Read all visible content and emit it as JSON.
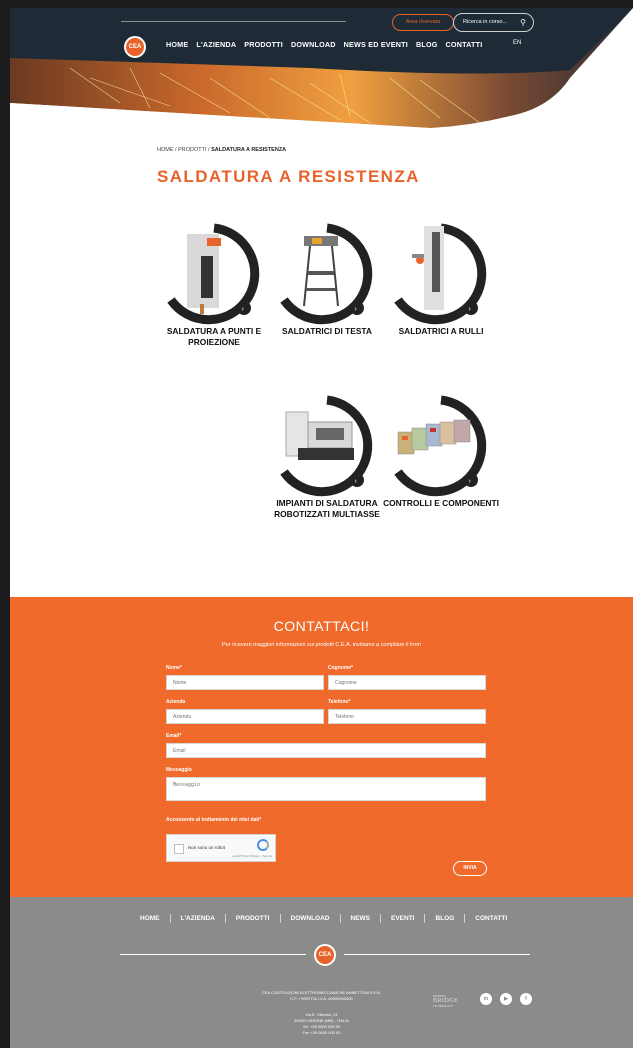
{
  "header": {
    "area_button": "Area riservata",
    "search_placeholder": "Ricerca in corso...",
    "logo": "CEA",
    "nav": [
      "HOME",
      "L'AZIENDA",
      "PRODOTTI",
      "DOWNLOAD",
      "NEWS ED EVENTI",
      "BLOG",
      "CONTATTI"
    ],
    "lang": "EN"
  },
  "breadcrumb": {
    "path": "HOME / PRODOTTI / ",
    "current": "SALDATURA A RESISTENZA"
  },
  "page_title": "SALDATURA A RESISTENZA",
  "products": [
    {
      "label": "SALDATURA A PUNTI E PROIEZIONE"
    },
    {
      "label": "SALDATRICI DI TESTA"
    },
    {
      "label": "SALDATRICI A RULLI"
    },
    {
      "label": "IMPIANTI DI SALDATURA ROBOTIZZATI MULTIASSE"
    },
    {
      "label": "CONTROLLI E COMPONENTI"
    }
  ],
  "contact": {
    "title": "CONTATTACI!",
    "subtitle": "Per ricevere maggiori informazioni sui prodotti C.E.A. invitiamo a compilare il form",
    "fields": {
      "name_label": "Nome*",
      "name_placeholder": "Nome",
      "surname_label": "Cognome*",
      "surname_placeholder": "Cognome",
      "company_label": "Azienda",
      "company_placeholder": "Azienda",
      "phone_label": "Telefono*",
      "phone_placeholder": "Telefono",
      "email_label": "Email*",
      "email_placeholder": "Email",
      "message_label": "Messaggio",
      "message_placeholder": "Messaggio",
      "consent_label": "Acconsento al trattamento dei miei dati*"
    },
    "captcha_text": "Non sono un robot",
    "captcha_small": "reCAPTCHA Privacy - Termini",
    "send": "INVIA"
  },
  "footer": {
    "nav": [
      "HOME",
      "L'AZIENDA",
      "PRODOTTI",
      "DOWNLOAD",
      "NEWS",
      "EVENTI",
      "BLOG",
      "CONTATTI"
    ],
    "logo": "CEA",
    "company_line1": "CEA COSTRUZIONI ELETTROMECCANICHE ANNETTONI S.P.A.",
    "company_line2": "C.F. / PARTITA I.V.A. 00000000000",
    "address_line1": "Via E. Villoresi, 21",
    "address_line2": "20900 LISSONE (MB) - ITALIA",
    "address_line3": "Tel. +39 0000 000 00",
    "address_line4": "Fax +39 0000 000 00",
    "bridge_small": "MEMBER",
    "bridge": "BRIDGE",
    "bridge_sub": "TECHNOLOGY",
    "social": [
      "in",
      "▶",
      "f"
    ]
  },
  "colors": {
    "accent": "#e8632b",
    "header_dark": "#1e2a36",
    "footer_gray": "#8b8b8b",
    "contact_orange": "#ef6a2b"
  }
}
